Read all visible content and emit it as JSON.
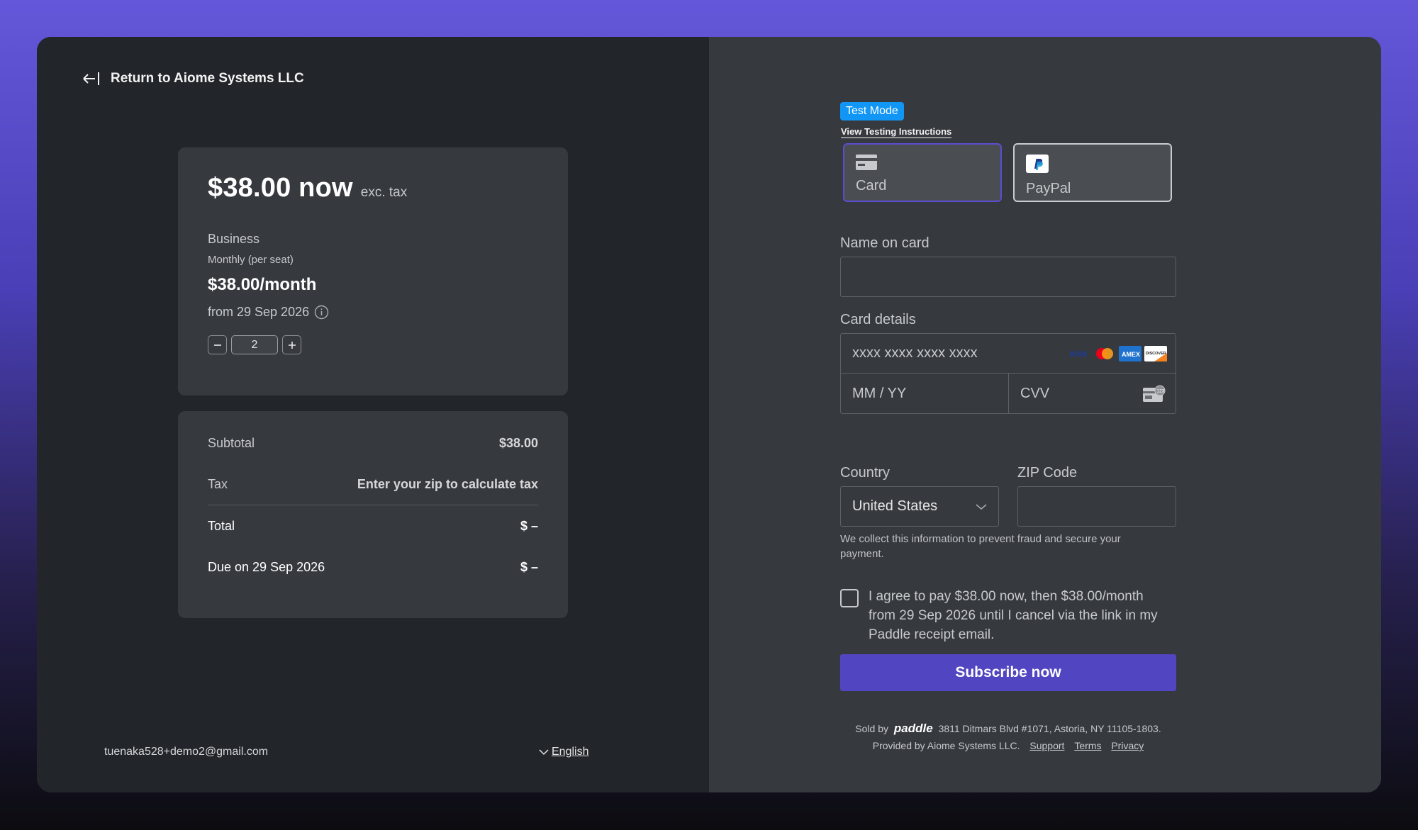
{
  "header": {
    "return_label": "Return to Aiome Systems LLC"
  },
  "summary": {
    "price_now": "$38.00 now",
    "price_suffix": "exc. tax",
    "plan_name": "Business",
    "plan_period": "Monthly (per seat)",
    "plan_price": "$38.00/month",
    "plan_from": "from 29 Sep 2026",
    "quantity": "2"
  },
  "totals": {
    "subtotal_label": "Subtotal",
    "subtotal_value": "$38.00",
    "tax_label": "Tax",
    "tax_value": "Enter your zip to calculate tax",
    "total_label": "Total",
    "total_value": "$ –",
    "due_label": "Due on 29 Sep 2026",
    "due_value": "$ –"
  },
  "footer": {
    "email": "tuenaka528+demo2@gmail.com",
    "language": "English"
  },
  "checkout": {
    "test_mode": "Test Mode",
    "testing_link": "View Testing Instructions",
    "methods": {
      "card": "Card",
      "paypal": "PayPal"
    },
    "name_label": "Name on card",
    "card_label": "Card details",
    "card_placeholder": "xxxx xxxx xxxx xxxx",
    "expiry_placeholder": "MM / YY",
    "cvv_placeholder": "CVV",
    "country_label": "Country",
    "country_value": "United States",
    "zip_label": "ZIP Code",
    "note": "We collect this information to prevent fraud and secure your payment.",
    "agree_text": "I agree to pay $38.00 now, then $38.00/month from 29 Sep 2026 until I cancel via the link in my Paddle receipt email.",
    "subscribe_label": "Subscribe now",
    "sold_by": "Sold by",
    "brand": "paddle",
    "address": "3811 Ditmars Blvd #1071, Astoria, NY 11105-1803.",
    "provided_by": "Provided by  Aiome Systems LLC.",
    "support": "Support",
    "terms": "Terms",
    "privacy": "Privacy"
  },
  "colors": {
    "accent": "#5145c1",
    "test_badge": "#1196f5",
    "panel": "#363a3f"
  }
}
